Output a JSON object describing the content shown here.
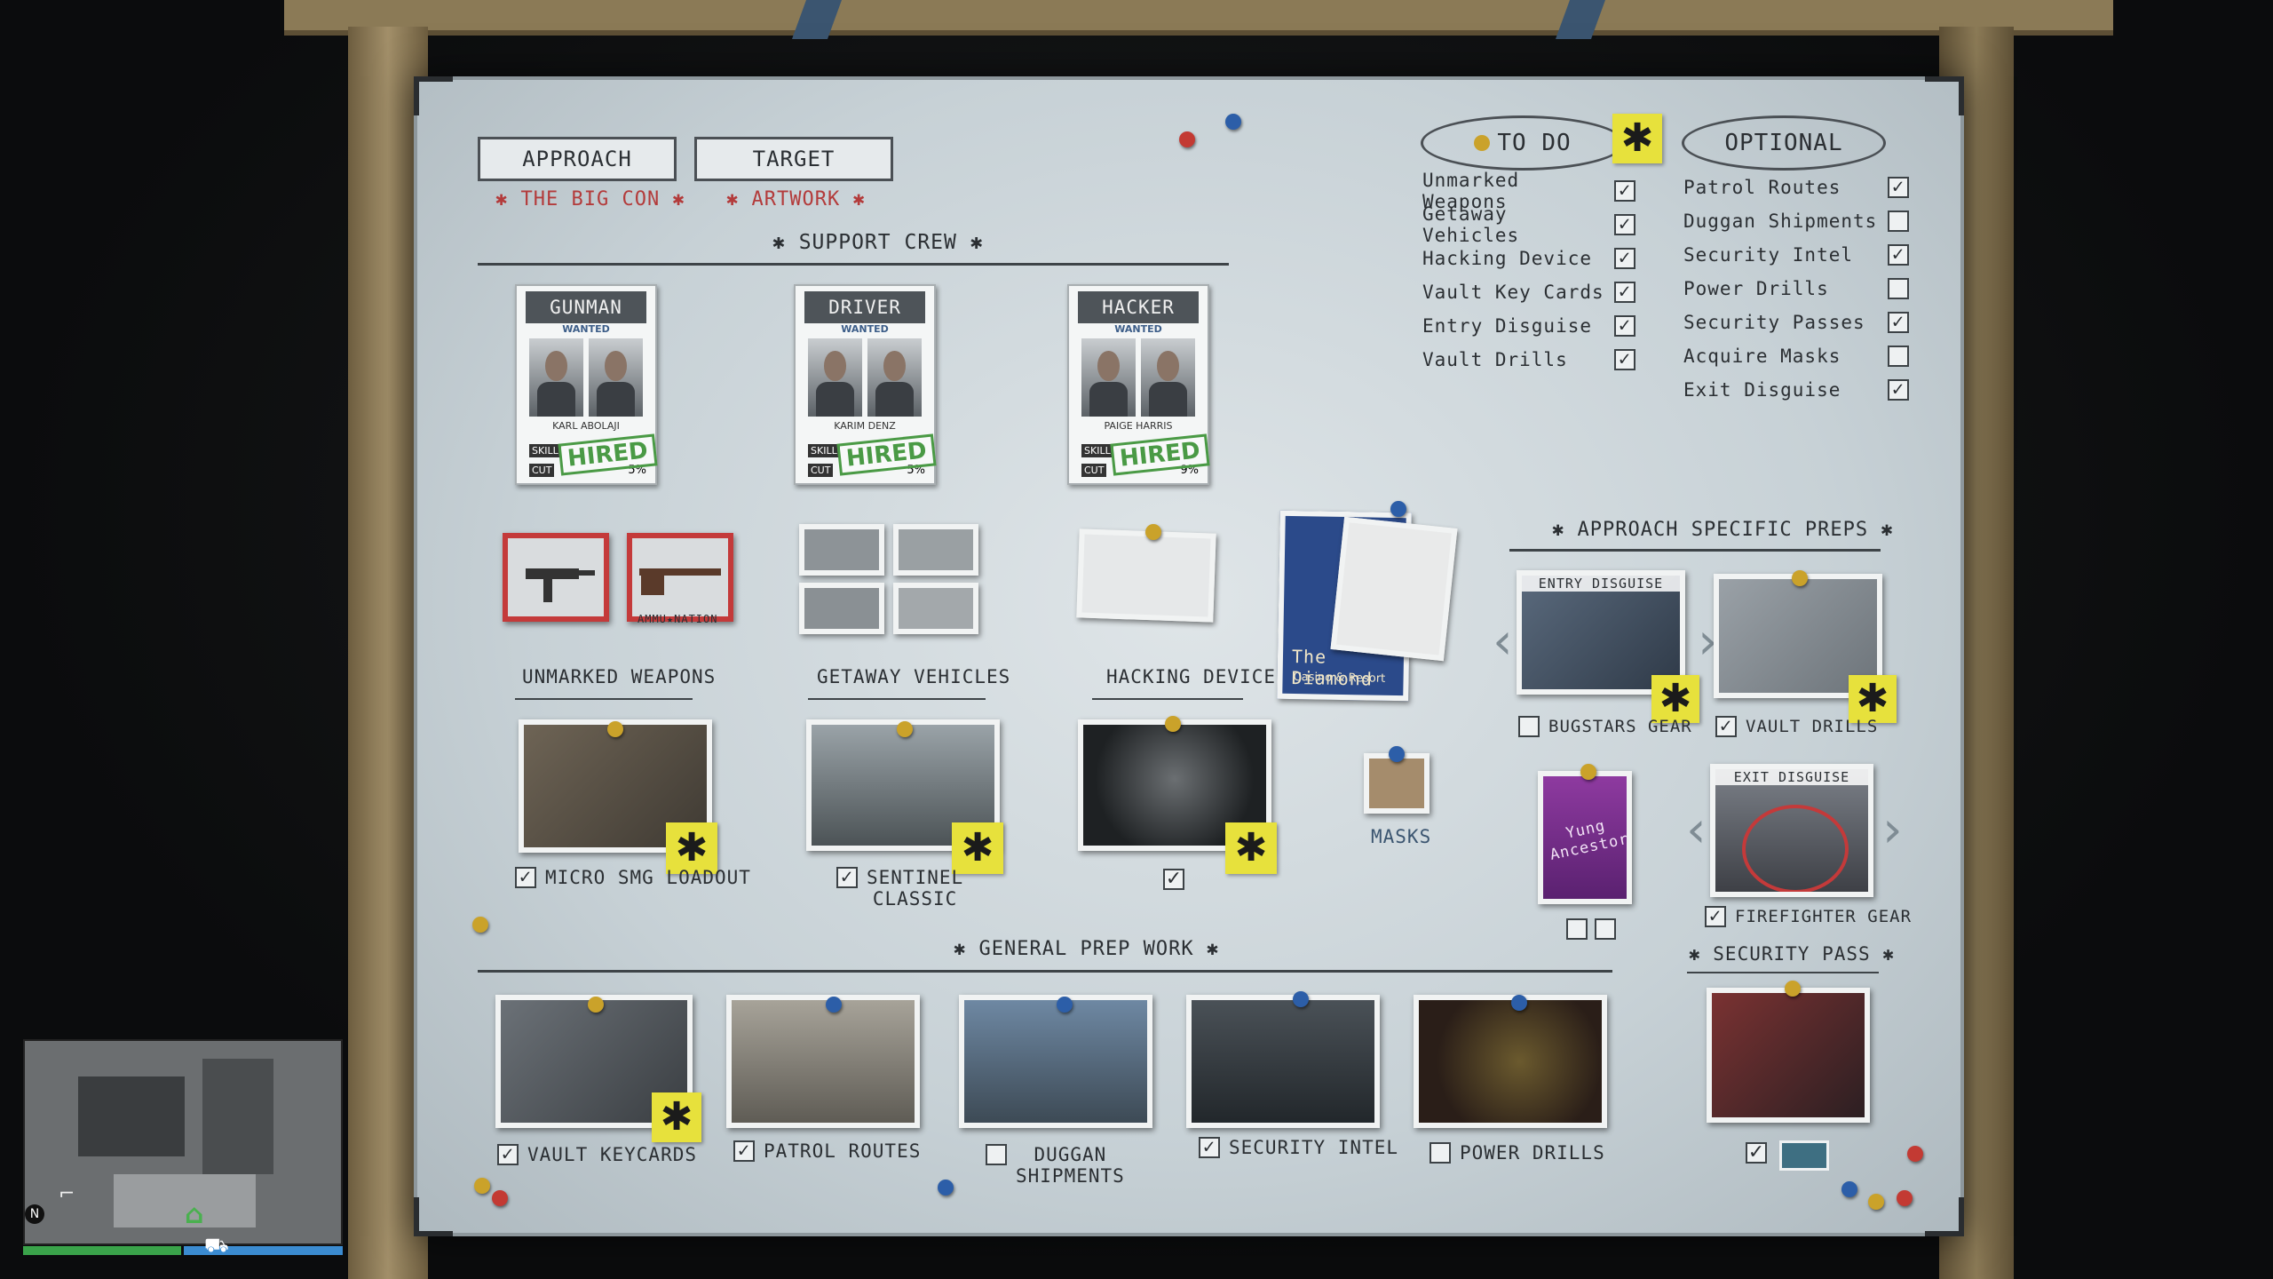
{
  "tabs": {
    "approach": {
      "label": "APPROACH",
      "value": "✱ THE BIG CON ✱"
    },
    "target": {
      "label": "TARGET",
      "value": "✱ ARTWORK ✱"
    }
  },
  "support_crew": {
    "title": "✱ SUPPORT CREW ✱",
    "members": [
      {
        "role": "GUNMAN",
        "wanted": "WANTED",
        "name": "KARL ABOLAJI",
        "skill_tag": "SKILL",
        "cut_tag": "CUT",
        "cut": "5%",
        "status": "HIRED"
      },
      {
        "role": "DRIVER",
        "wanted": "WANTED",
        "name": "KARIM DENZ",
        "skill_tag": "SKILL",
        "cut_tag": "CUT",
        "cut": "5%",
        "status": "HIRED"
      },
      {
        "role": "HACKER",
        "wanted": "WANTED",
        "name": "PAIGE HARRIS",
        "skill_tag": "SKILL",
        "cut_tag": "CUT",
        "cut": "9%",
        "status": "HIRED"
      }
    ]
  },
  "crew_prep": [
    {
      "title": "UNMARKED WEAPONS",
      "selection": "MICRO SMG LOADOUT",
      "checked": true
    },
    {
      "title": "GETAWAY VEHICLES",
      "selection": "SENTINEL\nCLASSIC",
      "checked": true
    },
    {
      "title": "HACKING DEVICE",
      "selection": "",
      "checked": true
    }
  ],
  "weapon_brand": "AMMU★NATION",
  "masks": {
    "label": "MASKS"
  },
  "casino_poster": {
    "line1": "The Diamond",
    "line2": "Casino & Resort"
  },
  "mask_poster": {
    "text": "Yung Ancestor"
  },
  "todo": {
    "header": "TO DO",
    "items": [
      {
        "label": "Unmarked Weapons",
        "checked": true
      },
      {
        "label": "Getaway Vehicles",
        "checked": true
      },
      {
        "label": "Hacking Device",
        "checked": true
      },
      {
        "label": "Vault Key Cards",
        "checked": true
      },
      {
        "label": "Entry Disguise",
        "checked": true
      },
      {
        "label": "Vault Drills",
        "checked": true
      }
    ]
  },
  "optional": {
    "header": "OPTIONAL",
    "items": [
      {
        "label": "Patrol Routes",
        "checked": true
      },
      {
        "label": "Duggan Shipments",
        "checked": false
      },
      {
        "label": "Security Intel",
        "checked": true
      },
      {
        "label": "Power Drills",
        "checked": false
      },
      {
        "label": "Security Passes",
        "checked": true
      },
      {
        "label": "Acquire Masks",
        "checked": false
      },
      {
        "label": "Exit Disguise",
        "checked": true
      }
    ]
  },
  "approach_preps": {
    "title": "✱ APPROACH SPECIFIC PREPS ✱",
    "entry_disguise": {
      "header": "ENTRY DISGUISE",
      "label": "BUGSTARS GEAR",
      "checked": false
    },
    "vault_drills": {
      "label": "VAULT DRILLS",
      "checked": true
    },
    "exit_disguise": {
      "header": "EXIT DISGUISE",
      "label": "FIREFIGHTER GEAR",
      "checked": true
    },
    "security_pass": {
      "title": "✱ SECURITY PASS ✱",
      "checked": true
    }
  },
  "general_prep": {
    "title": "✱ GENERAL PREP WORK ✱",
    "items": [
      {
        "label": "VAULT KEYCARDS",
        "checked": true
      },
      {
        "label": "PATROL ROUTES",
        "checked": true
      },
      {
        "label": "DUGGAN\nSHIPMENTS",
        "checked": false
      },
      {
        "label": "SECURITY INTEL",
        "checked": true
      },
      {
        "label": "POWER DRILLS",
        "checked": false
      }
    ]
  },
  "hud": {
    "compass": "N",
    "health": 1.0,
    "armor": 1.0
  },
  "colors": {
    "sticky": "#e7e13c",
    "hired": "#4a9a45",
    "accent_red": "#b33b3b"
  },
  "icons": {
    "sticky": "asterisk-icon",
    "check": "check-icon",
    "arrow_left": "chevron-left-icon",
    "arrow_right": "chevron-right-icon"
  }
}
